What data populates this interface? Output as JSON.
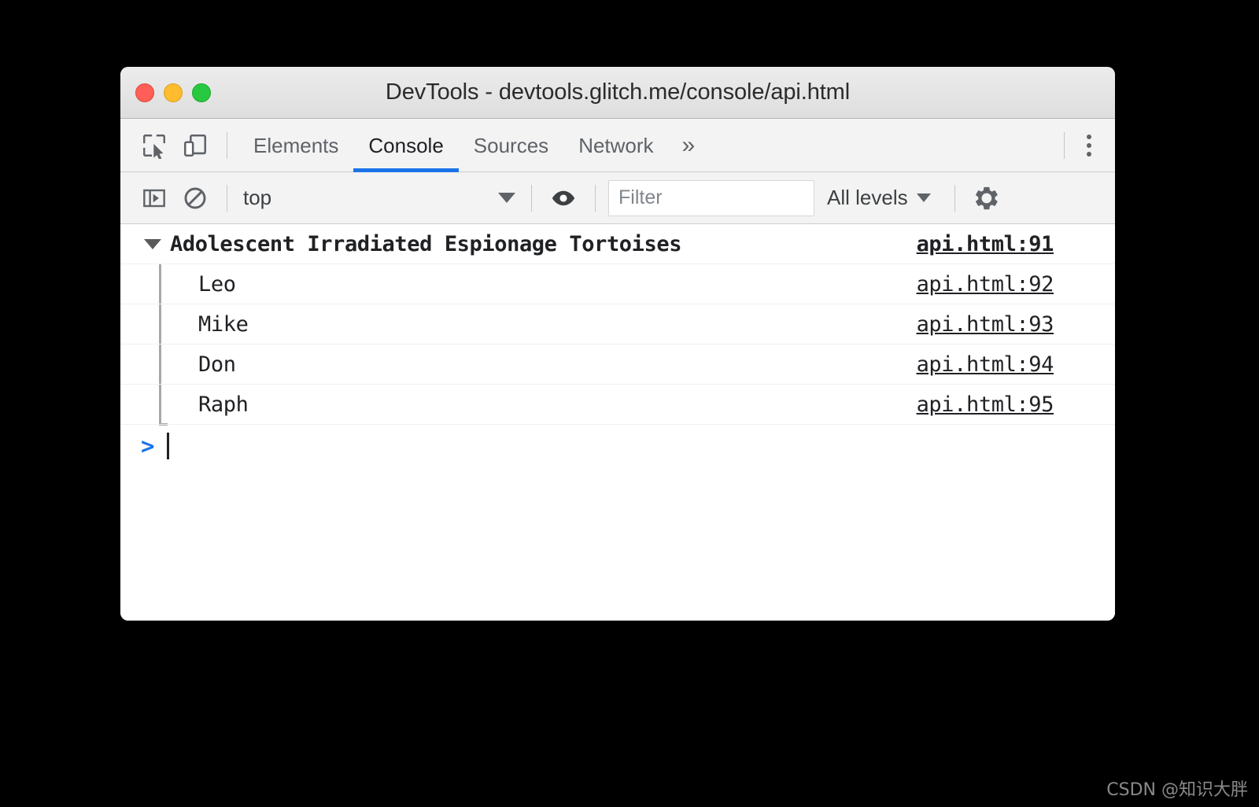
{
  "window": {
    "title": "DevTools - devtools.glitch.me/console/api.html",
    "traffic_lights": [
      {
        "name": "close",
        "color": "#ff5f57"
      },
      {
        "name": "minimize",
        "color": "#febc2e"
      },
      {
        "name": "maximize",
        "color": "#28c840"
      }
    ]
  },
  "tabbar": {
    "icons": [
      {
        "name": "inspect-element-icon"
      },
      {
        "name": "device-toolbar-icon"
      }
    ],
    "tabs": [
      {
        "label": "Elements",
        "active": false
      },
      {
        "label": "Console",
        "active": true
      },
      {
        "label": "Sources",
        "active": false
      },
      {
        "label": "Network",
        "active": false
      }
    ],
    "more_tabs_label": "»",
    "menu_icon": "more-vertical-icon",
    "active_accent": "#1a73e8"
  },
  "console_toolbar": {
    "sidebar_toggle_icon": "console-sidebar-icon",
    "clear_console_icon": "clear-console-icon",
    "context_value": "top",
    "live_expression_icon": "eye-icon",
    "filter_placeholder": "Filter",
    "filter_value": "",
    "levels_value": "All levels",
    "settings_icon": "gear-icon"
  },
  "console": {
    "group": {
      "title": "Adolescent Irradiated Espionage Tortoises",
      "link": "api.html:91",
      "expanded": true,
      "entries": [
        {
          "text": "Leo",
          "link": "api.html:92"
        },
        {
          "text": "Mike",
          "link": "api.html:93"
        },
        {
          "text": "Don",
          "link": "api.html:94"
        },
        {
          "text": "Raph",
          "link": "api.html:95"
        }
      ]
    },
    "prompt_chevron": ">",
    "prompt_value": ""
  },
  "watermark": {
    "text": "CSDN @知识大胖"
  }
}
